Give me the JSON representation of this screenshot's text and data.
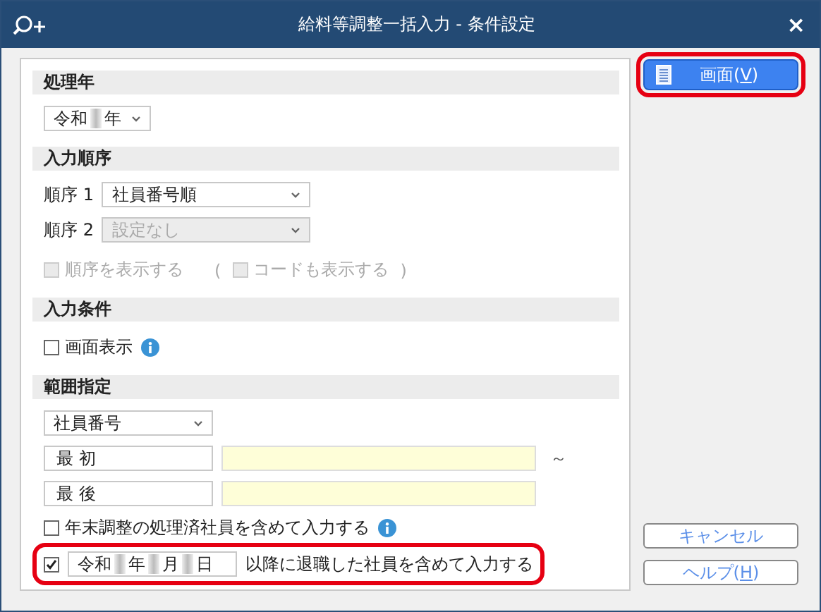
{
  "window": {
    "title": "給料等調整一括入力 - 条件設定",
    "close": "×"
  },
  "processing_year": {
    "heading": "処理年",
    "era": "令和",
    "unit": "年"
  },
  "input_order": {
    "heading": "入力順序",
    "rows": [
      {
        "label": "順序 1",
        "value": "社員番号順",
        "disabled": false
      },
      {
        "label": "順序 2",
        "value": "設定なし",
        "disabled": true
      }
    ],
    "paren_open": "(",
    "paren_close": ")",
    "options": [
      {
        "label": "順序を表示する",
        "checked": false,
        "disabled": true
      },
      {
        "label": "コードも表示する",
        "checked": false,
        "disabled": true
      }
    ]
  },
  "input_condition": {
    "heading": "入力条件",
    "options": [
      {
        "label": "画面表示",
        "checked": false,
        "info": true
      }
    ]
  },
  "range": {
    "heading": "範囲指定",
    "key": "社員番号",
    "tilde": "～",
    "bounds": [
      {
        "label": "最 初"
      },
      {
        "label": "最 後"
      }
    ],
    "options": [
      {
        "kind": "plain",
        "label": "年末調整の処理済社員を含めて入力する",
        "checked": false,
        "info": true,
        "highlighted": false
      },
      {
        "kind": "date",
        "era": "令和",
        "parts": [
          "年",
          "月",
          "日"
        ],
        "label": "以降に退職した社員を含めて入力する",
        "checked": true,
        "info": false,
        "highlighted": true
      }
    ]
  },
  "buttons": [
    {
      "kind": "primary",
      "label_before": "画面(",
      "access_key": "V",
      "label_after": ")",
      "highlighted": true
    },
    {
      "kind": "secondary",
      "label_before": "キャンセル",
      "highlighted": false
    },
    {
      "kind": "secondary",
      "label_before": "ヘルプ(",
      "access_key": "H",
      "label_after": ")",
      "highlighted": false
    }
  ]
}
